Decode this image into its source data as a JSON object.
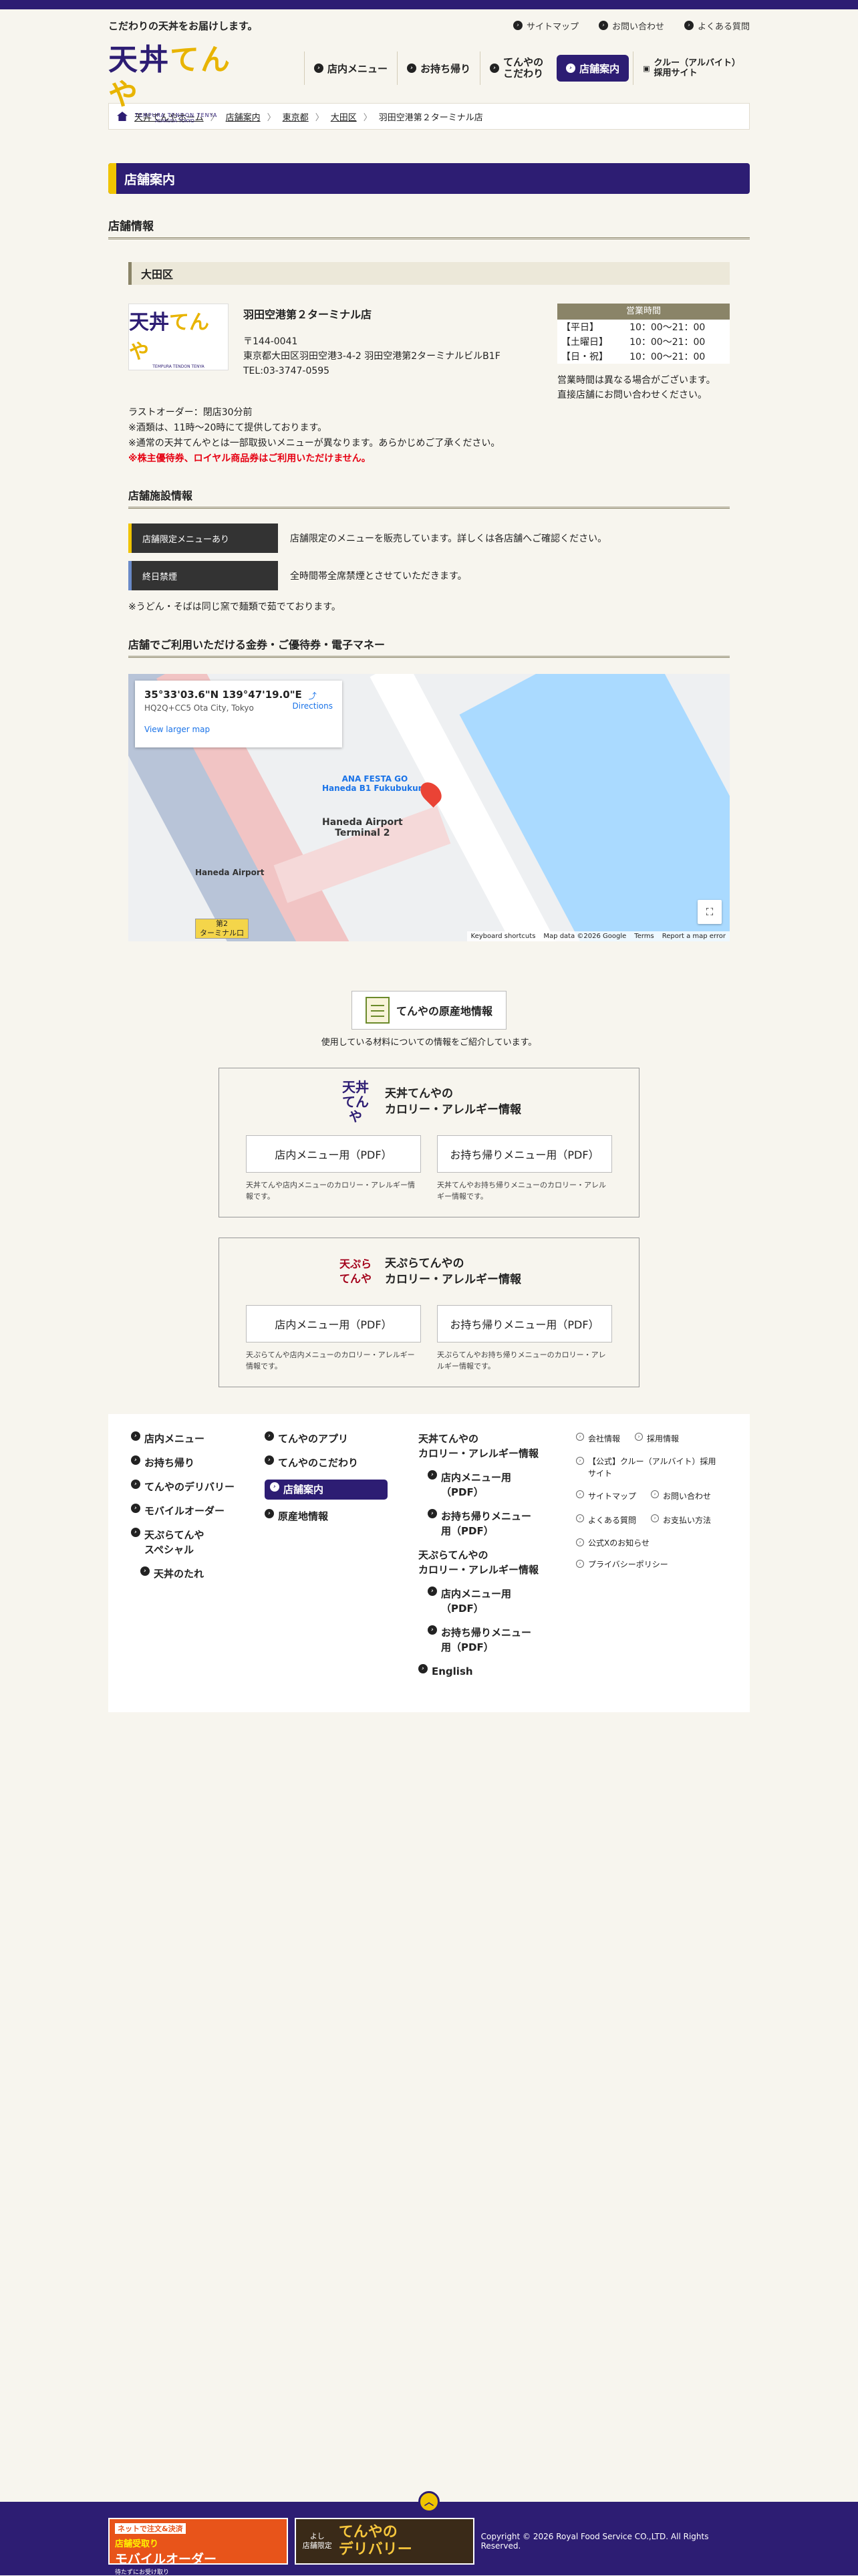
{
  "header": {
    "tagline": "こだわりの天丼をお届けします。",
    "utility_links": [
      "サイトマップ",
      "お問い合わせ",
      "よくある質問"
    ],
    "logo": {
      "mark_a": "天丼",
      "mark_b": "てんや",
      "sub": "TEMPURA TENDON TENYA",
      "sub2": "ASAKUSA TOKYO"
    },
    "nav": [
      {
        "label": "店内メニュー"
      },
      {
        "label": "お持ち帰り"
      },
      {
        "label": "てんやの\nこだわり"
      },
      {
        "label": "店舗案内"
      },
      {
        "label": "クルー（アルバイト）\n採用サイト"
      }
    ]
  },
  "breadcrumb": [
    "天丼てんやホーム",
    "店舗案内",
    "東京都",
    "大田区",
    "羽田空港第２ターミナル店"
  ],
  "page_title": "店舗案内",
  "section_title": "店舗情報",
  "area": "大田区",
  "store": {
    "name": "羽田空港第２ターミナル店",
    "thumb_a": "天丼",
    "thumb_b": "てんや",
    "thumb_sub": "TEMPURA TENDON TENYA",
    "zip": "〒144-0041",
    "address": "東京都大田区羽田空港3-4-2 羽田空港第2ターミナルビルB1F",
    "tel": "TEL:03-3747-0595"
  },
  "hours": {
    "title": "営業時間",
    "rows": [
      {
        "day": "【平日】",
        "time": "10：00〜21：00"
      },
      {
        "day": "【土曜日】",
        "time": "10：00〜21：00"
      },
      {
        "day": "【日・祝】",
        "time": "10：00〜21：00"
      }
    ],
    "note1": "営業時間は異なる場合がございます。",
    "note2": "直接店舗にお問い合わせください。"
  },
  "notes": {
    "n1": "ラストオーダー：閉店30分前",
    "n2": "※酒類は、11時〜20時にて提供しております。",
    "n3": "※通常の天丼てんやとは一部取扱いメニューが異なります。あらかじめご了承ください。",
    "n4": "※株主優待券、ロイヤル商品券はご利用いただけません。"
  },
  "facility": {
    "title": "店舗施設情報",
    "rows": [
      {
        "tag": "店舗限定メニューあり",
        "desc": "店舗限定のメニューを販売しています。詳しくは各店舗へご確認ください。"
      },
      {
        "tag": "終日禁煙",
        "desc": "全時間帯全席禁煙とさせていただきます。"
      }
    ],
    "foot": "※うどん・そばは同じ窯で麺類で茹でております。"
  },
  "payment_title": "店舗でご利用いただける金券・ご優待券・電子マネー",
  "map": {
    "coords": "35°33'03.6\"N 139°47'19.0\"E",
    "plus": "HQ2Q+CC5 Ota City, Tokyo",
    "larger": "View larger map",
    "directions": "Directions",
    "label1": "ANA FESTA GO\nHaneda B1 Fukubukuro",
    "label2": "Haneda Airport\nTerminal 2",
    "label3": "Haneda Airport",
    "badge": "第2\nターミナル口",
    "footer": [
      "Keyboard shortcuts",
      "Map data ©2026 Google",
      "Terms",
      "Report a map error"
    ]
  },
  "origin": {
    "button": "てんやの原産地情報",
    "caption": "使用している材料についての情報をご紹介しています。"
  },
  "calorie": [
    {
      "logo": "天丼\nてんや",
      "title": "天丼てんやの\nカロリー・アレルギー情報",
      "b1": "店内メニュー用（PDF）",
      "d1": "天丼てんや店内メニューのカロリー・アレルギー情報です。",
      "b2": "お持ち帰りメニュー用（PDF）",
      "d2": "天丼てんやお持ち帰りメニューのカロリー・アレルギー情報です。"
    },
    {
      "logo": "天ぷら\nてんや",
      "title": "天ぷらてんやの\nカロリー・アレルギー情報",
      "b1": "店内メニュー用（PDF）",
      "d1": "天ぷらてんや店内メニューのカロリー・アレルギー情報です。",
      "b2": "お持ち帰りメニュー用（PDF）",
      "d2": "天ぷらてんやお持ち帰りメニューのカロリー・アレルギー情報です。"
    }
  ],
  "footer_nav": {
    "col1": [
      "店内メニュー",
      "お持ち帰り",
      "てんやのデリバリー",
      "モバイルオーダー",
      "天ぷらてんや\nスペシャル",
      "天丼のたれ"
    ],
    "col2": [
      "てんやのアプリ",
      "てんやのこだわり",
      "店舗案内",
      "原産地情報"
    ],
    "col3_h1": "天丼てんやの\nカロリー・アレルギー情報",
    "col3_a": [
      "店内メニュー用\n（PDF）",
      "お持ち帰りメニュー\n用（PDF）"
    ],
    "col3_h2": "天ぷらてんやの\nカロリー・アレルギー情報",
    "col3_b": [
      "店内メニュー用\n（PDF）",
      "お持ち帰りメニュー\n用（PDF）"
    ],
    "col3_en": "English",
    "col4": {
      "p1": [
        "会社情報",
        "採用情報"
      ],
      "crew": "【公式】クルー（アルバイト）採用サイト",
      "p2": [
        "サイトマップ",
        "お問い合わせ"
      ],
      "p3": [
        "よくある質問",
        "お支払い方法"
      ],
      "x": "公式Xのお知らせ",
      "privacy": "プライバシーポリシー"
    }
  },
  "bottom": {
    "ban1_l1": "ネットで注文&決済",
    "ban1_l2": "店舗受取り",
    "ban1_l3": "モバイルオーダー",
    "ban1_l4": "待たずにお受け取り",
    "ban2_s": "よし\n店舗限定",
    "ban2_b": "てんやの\nデリバリー",
    "copyright": "Copyright © 2026 Royal Food Service CO.,LTD. All Rights Reserved."
  },
  "colors": {
    "brand": "#2d1d73",
    "accent": "#f0c400",
    "warning": "#e60012"
  }
}
